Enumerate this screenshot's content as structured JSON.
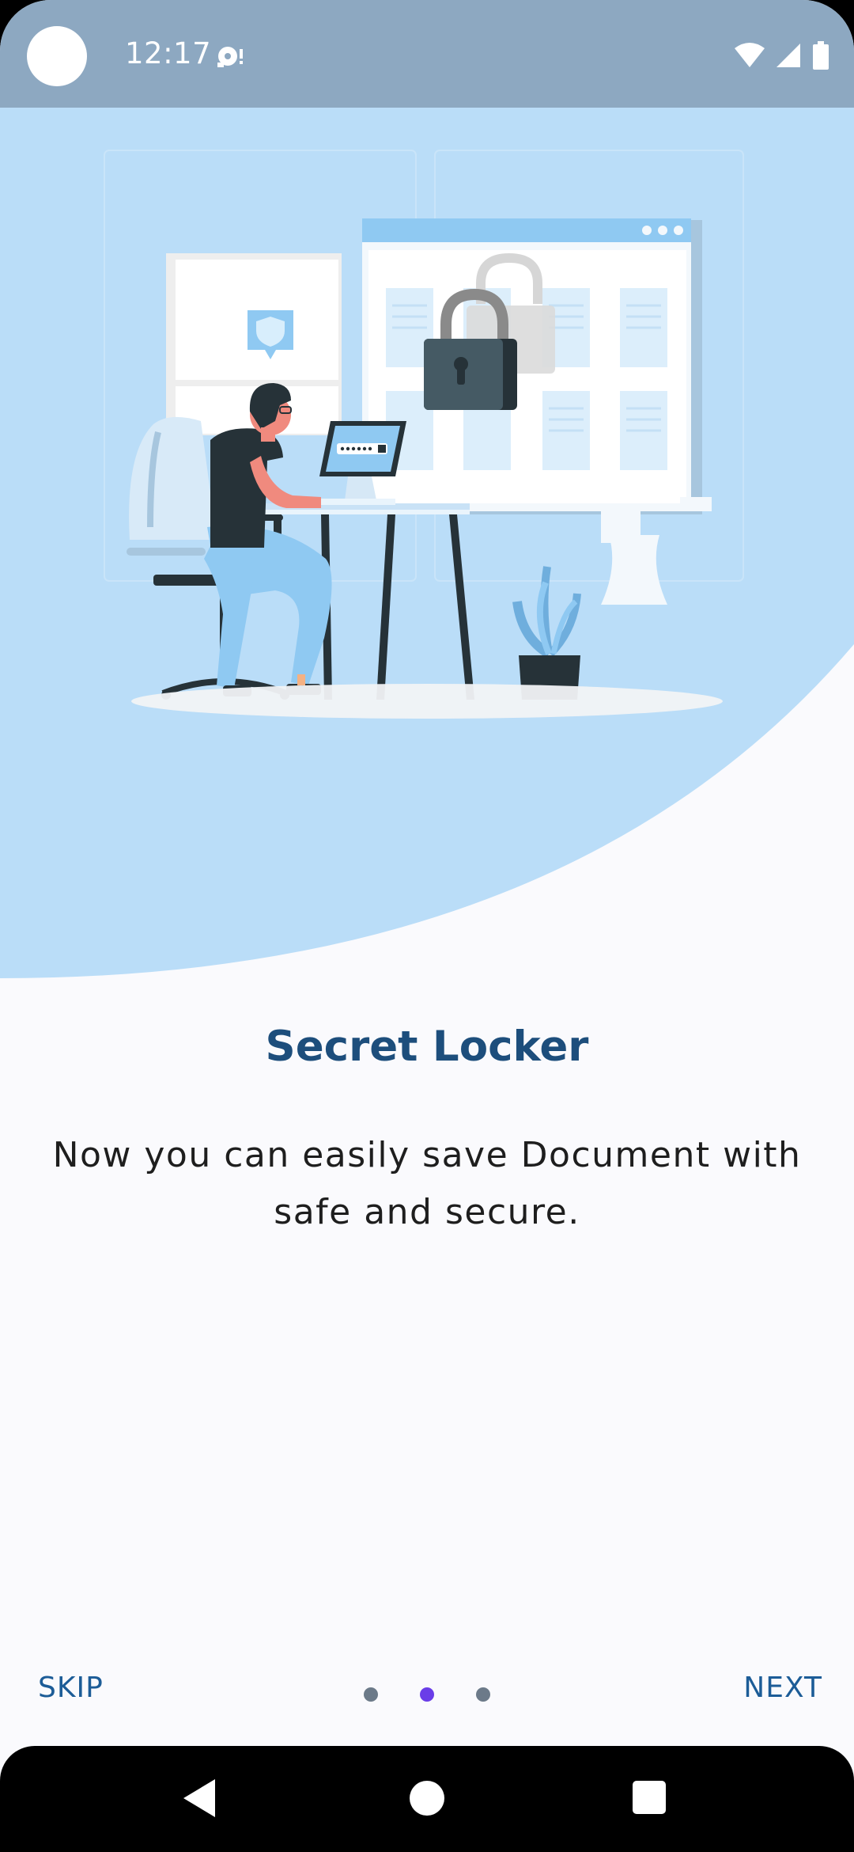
{
  "status_bar": {
    "time": "12:17",
    "icons": [
      "camera-cutout",
      "media-notification-icon",
      "wifi-icon",
      "cell-signal-icon",
      "battery-icon"
    ]
  },
  "onboarding": {
    "title": "Secret Locker",
    "description": "Now you can easily save Document with safe and secure.",
    "skip_label": "SKIP",
    "next_label": "NEXT",
    "page_indicator": {
      "total": 3,
      "current": 2
    }
  },
  "nav_bar": {
    "icons": [
      "back-icon",
      "home-icon",
      "recents-icon"
    ]
  },
  "colors": {
    "status_bar": "#8DA8C1",
    "hero_background": "#BADDF8",
    "page_background": "#FAFAFD",
    "title": "#1D4E7C",
    "buttons": "#1C5C97",
    "dot_active": "#6A3DE8",
    "dot_inactive": "#6C7A89"
  }
}
